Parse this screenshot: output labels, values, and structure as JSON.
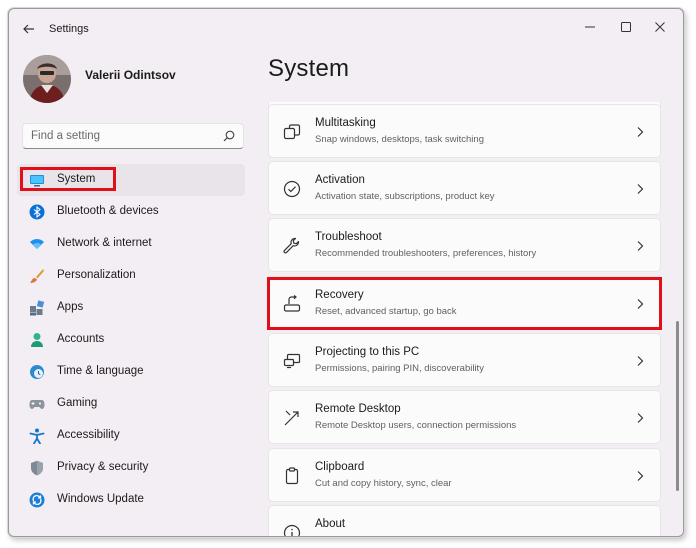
{
  "window": {
    "title": "Settings"
  },
  "user": {
    "name": "Valerii Odintsov"
  },
  "search": {
    "placeholder": "Find a setting"
  },
  "sidebar": {
    "items": [
      {
        "label": "System",
        "icon": "system-icon",
        "selected": true
      },
      {
        "label": "Bluetooth & devices",
        "icon": "bluetooth-icon"
      },
      {
        "label": "Network & internet",
        "icon": "wifi-icon"
      },
      {
        "label": "Personalization",
        "icon": "brush-icon"
      },
      {
        "label": "Apps",
        "icon": "apps-icon"
      },
      {
        "label": "Accounts",
        "icon": "person-icon"
      },
      {
        "label": "Time & language",
        "icon": "clock-globe-icon"
      },
      {
        "label": "Gaming",
        "icon": "gamepad-icon"
      },
      {
        "label": "Accessibility",
        "icon": "accessibility-icon"
      },
      {
        "label": "Privacy & security",
        "icon": "shield-icon"
      },
      {
        "label": "Windows Update",
        "icon": "update-icon"
      }
    ]
  },
  "main": {
    "title": "System",
    "cards": [
      {
        "title": "Multitasking",
        "desc": "Snap windows, desktops, task switching",
        "icon": "multitasking-icon"
      },
      {
        "title": "Activation",
        "desc": "Activation state, subscriptions, product key",
        "icon": "check-circle-icon"
      },
      {
        "title": "Troubleshoot",
        "desc": "Recommended troubleshooters, preferences, history",
        "icon": "wrench-icon"
      },
      {
        "title": "Recovery",
        "desc": "Reset, advanced startup, go back",
        "icon": "recovery-icon"
      },
      {
        "title": "Projecting to this PC",
        "desc": "Permissions, pairing PIN, discoverability",
        "icon": "projecting-icon"
      },
      {
        "title": "Remote Desktop",
        "desc": "Remote Desktop users, connection permissions",
        "icon": "remote-desktop-icon"
      },
      {
        "title": "Clipboard",
        "desc": "Cut and copy history, sync, clear",
        "icon": "clipboard-icon"
      },
      {
        "title": "About",
        "desc": "",
        "icon": "info-icon"
      }
    ]
  },
  "colors": {
    "highlight": "#e0101a",
    "accent": "#0067c0",
    "window_bg": "#f3eef3",
    "card_bg": "#fbfbfb"
  }
}
